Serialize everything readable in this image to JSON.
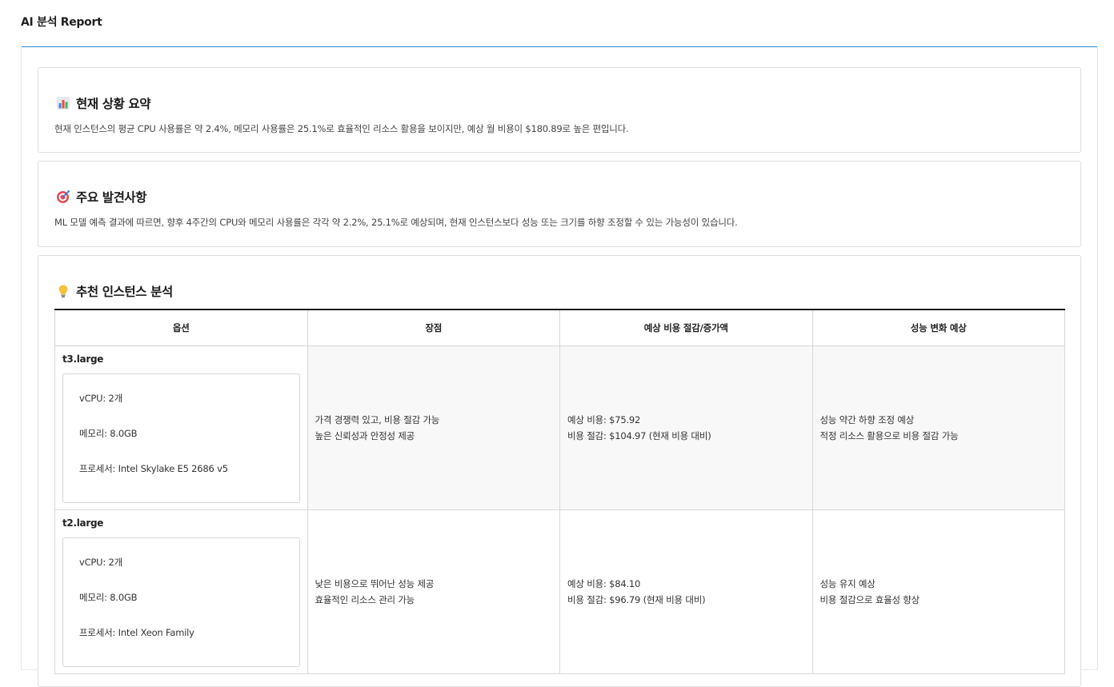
{
  "page": {
    "title": "AI 분석 Report"
  },
  "summary": {
    "icon": "bar-chart-icon",
    "title": "현재 상황 요약",
    "text": "현재 인스턴스의 평균 CPU 사용률은 약 2.4%, 메모리 사용률은 25.1%로 효율적인 리소스 활용을 보이지만, 예상 월 비용이 $180.89로 높은 편입니다."
  },
  "findings": {
    "icon": "target-icon",
    "title": "주요 발견사항",
    "text": "ML 모델 예측 결과에 따르면, 향후 4주간의 CPU와 메모리 사용률은 각각 약 2.2%, 25.1%로 예상되며, 현재 인스턴스보다 성능 또는 크기를 하향 조정할 수 있는 가능성이 있습니다."
  },
  "recommend": {
    "icon": "lightbulb-icon",
    "title": "추천 인스턴스 분석",
    "columns": [
      "옵션",
      "장점",
      "예상 비용 절감/증가액",
      "성능 변화 예상"
    ],
    "rows": [
      {
        "name": "t3.large",
        "specs": [
          "vCPU: 2개",
          "메모리: 8.0GB",
          "프로세서: Intel Skylake E5 2686 v5"
        ],
        "pros": [
          "가격 경쟁력 있고, 비용 절감 가능",
          "높은 신뢰성과 안정성 제공"
        ],
        "cost": [
          "예상 비용: $75.92",
          "비용 절감: $104.97 (현재 비용 대비)"
        ],
        "perf": [
          "성능 약간 하향 조정 예상",
          "적정 리소스 활용으로 비용 절감 가능"
        ]
      },
      {
        "name": "t2.large",
        "specs": [
          "vCPU: 2개",
          "메모리: 8.0GB",
          "프로세서: Intel Xeon Family"
        ],
        "pros": [
          "낮은 비용으로 뛰어난 성능 제공",
          "효율적인 리소스 관리 가능"
        ],
        "cost": [
          "예상 비용: $84.10",
          "비용 절감: $96.79 (현재 비용 대비)"
        ],
        "perf": [
          "성능 유지 예상",
          "비용 절감으로 효율성 향상"
        ]
      }
    ]
  }
}
